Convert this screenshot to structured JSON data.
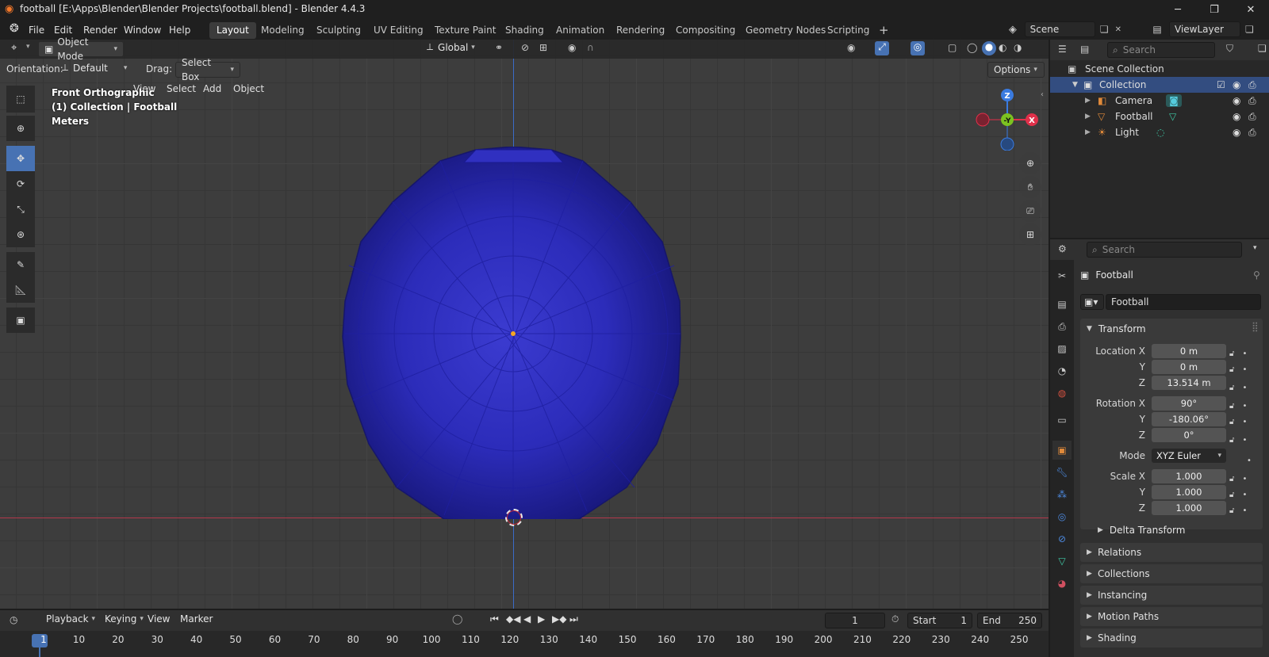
{
  "window": {
    "title": "football [E:\\Apps\\Blender\\Blender Projects\\football.blend] - Blender 4.4.3",
    "controls": [
      "─",
      "❐",
      "✕"
    ]
  },
  "menu": [
    "File",
    "Edit",
    "Render",
    "Window",
    "Help"
  ],
  "workspaces": [
    "Layout",
    "Modeling",
    "Sculpting",
    "UV Editing",
    "Texture Paint",
    "Shading",
    "Animation",
    "Rendering",
    "Compositing",
    "Geometry Nodes",
    "Scripting"
  ],
  "active_workspace": "Layout",
  "scene": "Scene",
  "view_layer": "ViewLayer",
  "viewport_header": {
    "mode": "Object Mode",
    "menus": [
      "View",
      "Select",
      "Add",
      "Object"
    ],
    "transform_space": "Global"
  },
  "tool_header": {
    "orientation_label": "Orientation:",
    "orientation_value": "Default",
    "drag_label": "Drag:",
    "drag_value": "Select Box",
    "options": "Options"
  },
  "viewport_overlay": {
    "view_name": "Front Orthographic",
    "collection_info": "(1) Collection | Football",
    "units": "Meters"
  },
  "gizmo": {
    "z": "Z",
    "y": "-Y",
    "x": "X"
  },
  "outliner": {
    "search_placeholder": "Search",
    "root": "Scene Collection",
    "collection": "Collection",
    "items": [
      {
        "name": "Camera"
      },
      {
        "name": "Football"
      },
      {
        "name": "Light"
      }
    ]
  },
  "properties": {
    "search_placeholder": "Search",
    "object_name": "Football",
    "object_field": "Football",
    "transform": {
      "header": "Transform",
      "location_label": "Location X",
      "location": {
        "x": "0 m",
        "y": "0 m",
        "z": "13.514 m"
      },
      "rotation_label": "Rotation X",
      "rotation": {
        "x": "90°",
        "y": "-180.06°",
        "z": "0°"
      },
      "mode_label": "Mode",
      "mode": "XYZ Euler",
      "scale_label": "Scale X",
      "scale": {
        "x": "1.000",
        "y": "1.000",
        "z": "1.000"
      },
      "y_label": "Y",
      "z_label": "Z"
    },
    "sections": [
      "Delta Transform",
      "Relations",
      "Collections",
      "Instancing",
      "Motion Paths",
      "Shading"
    ]
  },
  "timeline": {
    "menus": [
      "Playback",
      "Keying",
      "View",
      "Marker"
    ],
    "current_frame": "1",
    "start_label": "Start",
    "start": "1",
    "end_label": "End",
    "end": "250",
    "ruler": [
      "1",
      "10",
      "20",
      "30",
      "40",
      "50",
      "60",
      "70",
      "80",
      "90",
      "100",
      "110",
      "120",
      "130",
      "140",
      "150",
      "160",
      "170",
      "180",
      "190",
      "200",
      "210",
      "220",
      "230",
      "240",
      "250"
    ]
  },
  "colors": {
    "accent": "#4772b3",
    "ball": "#2a2ab8",
    "x_axis": "#e0304a",
    "y_axis": "#7cc220",
    "z_axis": "#3a7be0"
  }
}
